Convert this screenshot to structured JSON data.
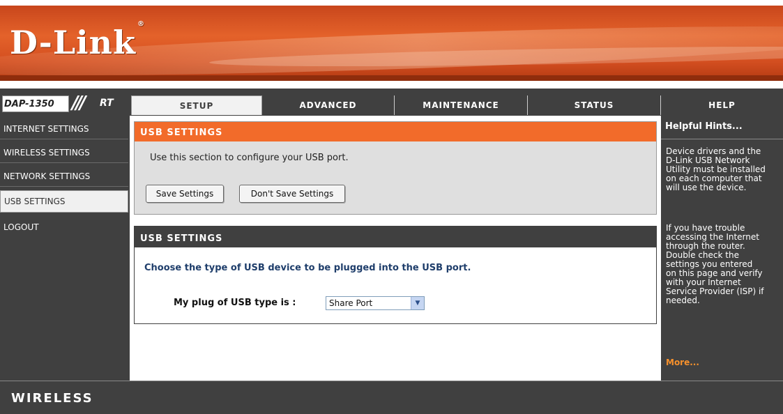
{
  "header": {
    "logo_text": "D-Link",
    "logo_mark": "®"
  },
  "model": {
    "name": "DAP-1350",
    "separator": "///",
    "mode": "RT"
  },
  "tabs": [
    {
      "label": "SETUP",
      "active": true
    },
    {
      "label": "ADVANCED",
      "active": false
    },
    {
      "label": "MAINTENANCE",
      "active": false
    },
    {
      "label": "STATUS",
      "active": false
    },
    {
      "label": "HELP",
      "active": false
    }
  ],
  "sidebar": {
    "items": [
      {
        "label": "INTERNET SETTINGS",
        "active": false
      },
      {
        "label": "WIRELESS SETTINGS",
        "active": false
      },
      {
        "label": "NETWORK SETTINGS",
        "active": false
      },
      {
        "label": "USB SETTINGS",
        "active": true
      },
      {
        "label": "LOGOUT",
        "active": false
      }
    ]
  },
  "section_intro": {
    "title": "USB SETTINGS",
    "description": "Use this section to configure your USB port.",
    "save_label": "Save Settings",
    "dont_save_label": "Don't Save Settings"
  },
  "section_usb": {
    "title": "USB SETTINGS",
    "instruction": "Choose the type of USB device to be plugged into the USB port.",
    "plug_label": "My plug of USB type is  :",
    "plug_value": "Share Port"
  },
  "help": {
    "title": "Helpful Hints...",
    "para1": "Device drivers and the\nD-Link USB Network\nUtility must be installed\non each computer that\nwill use the device.",
    "para2": "If you have trouble\naccessing the Internet\nthrough the router.\nDouble check the\nsettings you entered\non this page and verify\nwith your Internet\nService Provider (ISP) if\nneeded.",
    "more": "More..."
  },
  "footer": {
    "text": "WIRELESS"
  },
  "colors": {
    "orange_header": "#f26b2a",
    "dark_gray": "#404040",
    "link_orange": "#f7912c",
    "blue_text": "#1f3e6b"
  }
}
